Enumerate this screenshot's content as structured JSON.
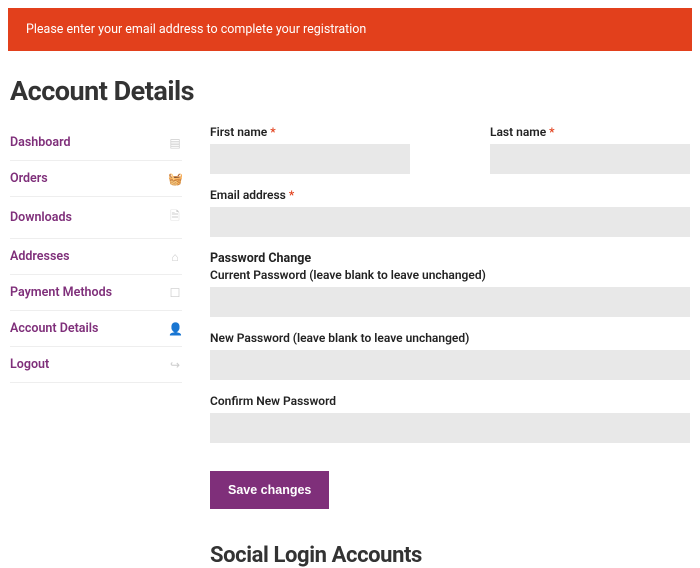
{
  "alert": {
    "message": "Please enter your email address to complete your registration"
  },
  "page_title": "Account Details",
  "nav": {
    "items": [
      {
        "label": "Dashboard",
        "icon": "▤"
      },
      {
        "label": "Orders",
        "icon": "🧺"
      },
      {
        "label": "Downloads",
        "icon": "🗎"
      },
      {
        "label": "Addresses",
        "icon": "⌂"
      },
      {
        "label": "Payment Methods",
        "icon": "☐"
      },
      {
        "label": "Account Details",
        "icon": "👤"
      },
      {
        "label": "Logout",
        "icon": "↪"
      }
    ]
  },
  "form": {
    "first_name_label": "First name",
    "last_name_label": "Last name",
    "email_label": "Email address",
    "password_section": "Password Change",
    "current_pw_label": "Current Password (leave blank to leave unchanged)",
    "new_pw_label": "New Password (leave blank to leave unchanged)",
    "confirm_pw_label": "Confirm New Password",
    "required_mark": "*",
    "submit_label": "Save changes"
  },
  "social_heading": "Social Login Accounts"
}
